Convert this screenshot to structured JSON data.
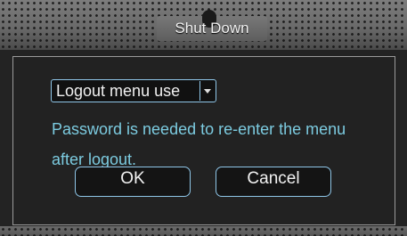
{
  "dialog": {
    "title": "Shut Down",
    "mode_select": {
      "value": "Logout menu use",
      "arrow_icon": "triangle-down-icon"
    },
    "message": "Password is needed to re-enter the menu after logout.",
    "ok_label": "OK",
    "cancel_label": "Cancel"
  },
  "colors": {
    "message_text": "#7ccbe0",
    "button_border": "#8fc6e8",
    "background": "#232323"
  }
}
